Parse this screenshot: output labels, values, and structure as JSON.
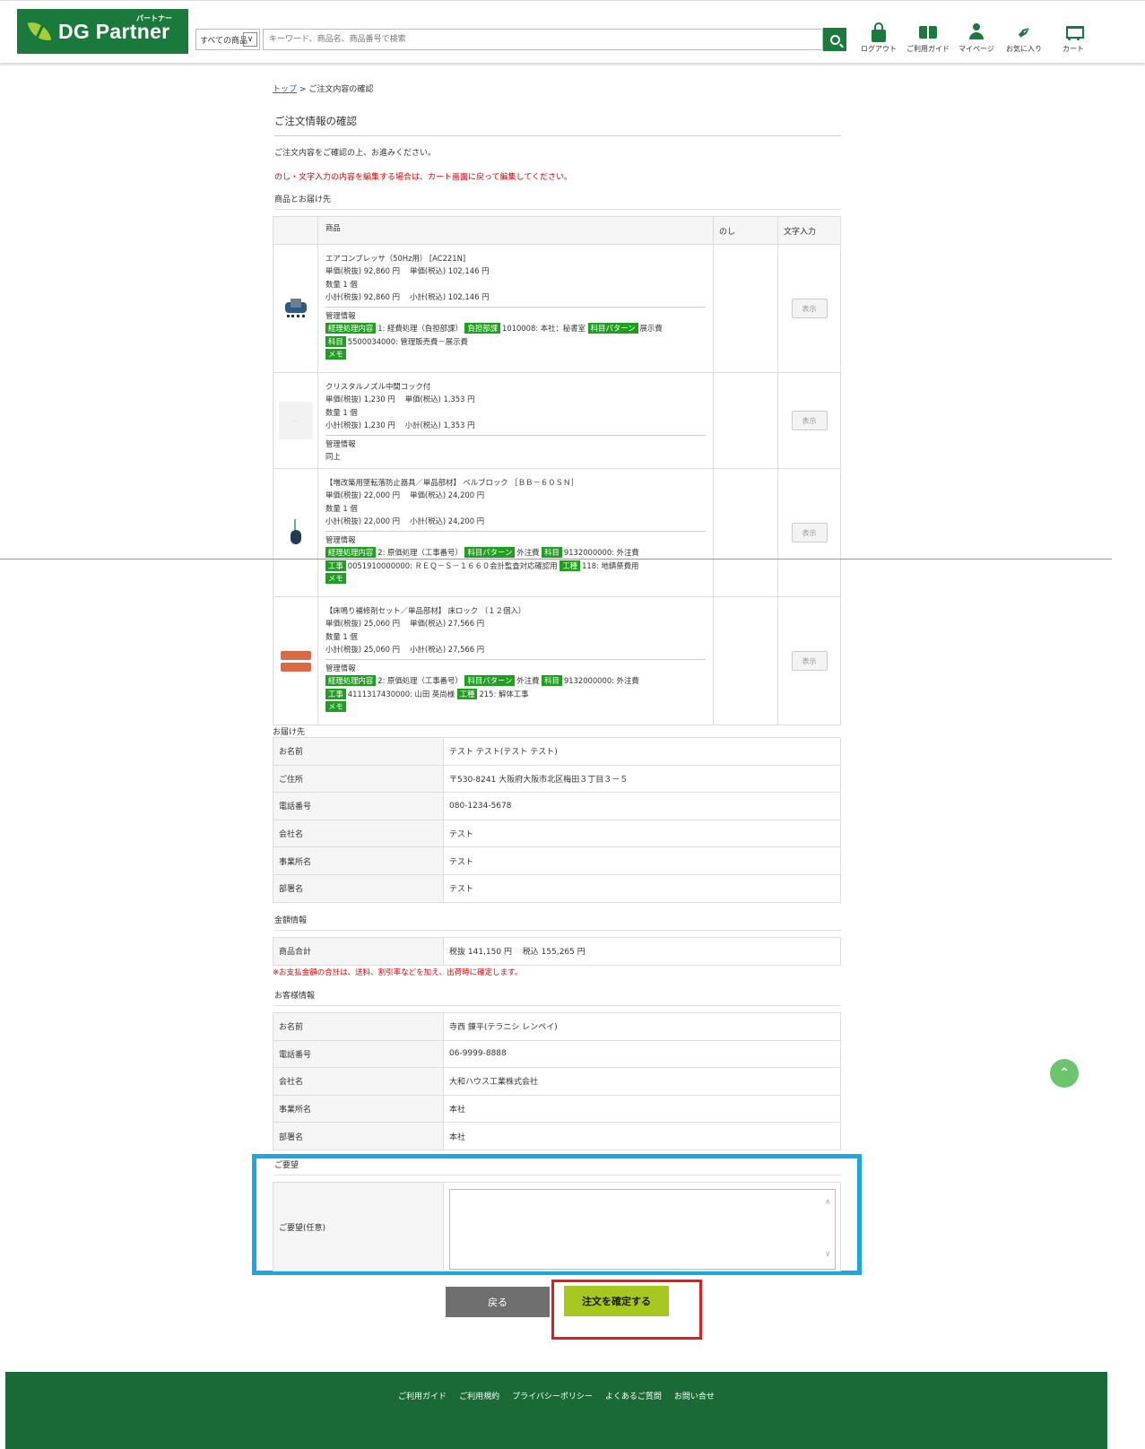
{
  "header": {
    "logo_text": "DG Partner",
    "logo_sub": "パートナー",
    "category_select": "すべての商品",
    "search_placeholder": "キーワード、商品名、商品番号で検索",
    "nav": [
      {
        "label": "ログアウト",
        "icon": "lock-icon"
      },
      {
        "label": "ご利用ガイド",
        "icon": "book-icon"
      },
      {
        "label": "マイページ",
        "icon": "user-icon"
      },
      {
        "label": "お気に入り",
        "icon": "clip-icon"
      },
      {
        "label": "カート",
        "icon": "cart-icon"
      }
    ]
  },
  "breadcrumb": {
    "top": "トップ",
    "sep": ">",
    "current": "ご注文内容の確認"
  },
  "page_title": "ご注文情報の確認",
  "intro": "ご注文内容をご確認の上、お進みください。",
  "warning": "のし・文字入力の内容を編集する場合は、カート画面に戻って編集してください。",
  "products_section": "商品とお届け先",
  "product_table": {
    "headers": {
      "product": "商品",
      "noshi": "のし",
      "text_input": "文字入力"
    },
    "show_label": "表示",
    "items": [
      {
        "name": "エアコンプレッサ（50Hz用） [AC221N]",
        "price": "単価(税抜) 92,860 円　 単価(税込) 102,146 円",
        "qty": "数量 1 個",
        "subtotal": "小計(税抜) 92,860 円　 小計(税込) 102,146 円",
        "mgmt_label": "管理情報",
        "mgmt_lines": [
          [
            {
              "tag": "経理処理内容"
            },
            {
              "text": "1: 経費処理（負担部課）"
            },
            {
              "tag": "負担部課"
            },
            {
              "text": "1010008: 本社：秘書室"
            },
            {
              "tag": "科目パターン"
            },
            {
              "text": "展示費"
            }
          ],
          [
            {
              "tag": "科目"
            },
            {
              "text": "5500034000: 管理販売費－展示費"
            }
          ],
          [
            {
              "tag": "メモ"
            }
          ]
        ]
      },
      {
        "name": "クリスタルノズル中間コック付",
        "price": "単価(税抜) 1,230 円　 単価(税込) 1,353 円",
        "qty": "数量 1 個",
        "subtotal": "小計(税抜) 1,230 円　 小計(税込) 1,353 円",
        "mgmt_label": "管理情報",
        "mgmt_lines": [
          [
            {
              "text": "同上"
            }
          ]
        ]
      },
      {
        "name": "【増改築用墜転落防止器具／単品部材】 ベルブロック ［ＢＢ－６０ＳＮ］",
        "price": "単価(税抜) 22,000 円　 単価(税込) 24,200 円",
        "qty": "数量 1 個",
        "subtotal": "小計(税抜) 22,000 円　 小計(税込) 24,200 円",
        "mgmt_label": "管理情報",
        "mgmt_lines": [
          [
            {
              "tag": "経理処理内容"
            },
            {
              "text": "2: 原価処理（工事番号）"
            },
            {
              "tag": "科目パターン"
            },
            {
              "text": "外注費"
            },
            {
              "tag": "科目"
            },
            {
              "text": "9132000000: 外注費"
            }
          ],
          [
            {
              "tag": "工事"
            },
            {
              "text": "0051910000000: ＲＥＱ－Ｓ－１６６０会計監査対応確認用"
            },
            {
              "tag": "工種"
            },
            {
              "text": "118: 地鎮祭費用"
            }
          ],
          [
            {
              "tag": "メモ"
            }
          ]
        ]
      },
      {
        "name": "【床鳴り補修剤セット／単品部材】 床ロック （１２個入）",
        "price": "単価(税抜) 25,060 円　 単価(税込) 27,566 円",
        "qty": "数量 1 個",
        "subtotal": "小計(税抜) 25,060 円　 小計(税込) 27,566 円",
        "mgmt_label": "管理情報",
        "mgmt_lines": [
          [
            {
              "tag": "経理処理内容"
            },
            {
              "text": "2: 原価処理（工事番号）"
            },
            {
              "tag": "科目パターン"
            },
            {
              "text": "外注費"
            },
            {
              "tag": "科目"
            },
            {
              "text": "9132000000: 外注費"
            }
          ],
          [
            {
              "tag": "工事"
            },
            {
              "text": "4111317430000: 山田 英尚様"
            },
            {
              "tag": "工種"
            },
            {
              "text": "215: 解体工事"
            }
          ],
          [
            {
              "tag": "メモ"
            }
          ]
        ]
      }
    ]
  },
  "delivery": {
    "title": "お届け先",
    "rows": [
      {
        "label": "お名前",
        "value": "テスト テスト(テスト テスト)"
      },
      {
        "label": "ご住所",
        "value": "〒530-8241 大阪府大阪市北区梅田３丁目３－５"
      },
      {
        "label": "電話番号",
        "value": "080-1234-5678"
      },
      {
        "label": "会社名",
        "value": "テスト"
      },
      {
        "label": "事業所名",
        "value": "テスト"
      },
      {
        "label": "部署名",
        "value": "テスト"
      }
    ]
  },
  "amount": {
    "title": "金額情報",
    "label": "商品合計",
    "value": "税抜 141,150 円　 税込 155,265 円",
    "note": "※お支払金額の合計は、送料、割引率などを加え、出荷時に確定します。"
  },
  "customer": {
    "title": "お客様情報",
    "rows": [
      {
        "label": "お名前",
        "value": "寺西 錬平(テラニシ レンペイ)"
      },
      {
        "label": "電話番号",
        "value": "06-9999-8888"
      },
      {
        "label": "会社名",
        "value": "大和ハウス工業株式会社"
      },
      {
        "label": "事業所名",
        "value": "本社"
      },
      {
        "label": "部署名",
        "value": "本社"
      }
    ]
  },
  "remarks": {
    "title": "ご要望",
    "label": "ご要望(任意)",
    "value": ""
  },
  "actions": {
    "back": "戻る",
    "confirm": "注文を確定する"
  },
  "footer_links": [
    "ご利用ガイド",
    "ご利用規約",
    "プライバシーポリシー",
    "よくあるご質問",
    "お問い合せ"
  ],
  "colors": {
    "brand_green": "#1a7a3c",
    "tag_green": "#1f9e1f",
    "confirm": "#a6c820",
    "warn_red": "#e00000",
    "highlight_blue": "#1aa7e6",
    "highlight_red": "#e21b1b"
  }
}
